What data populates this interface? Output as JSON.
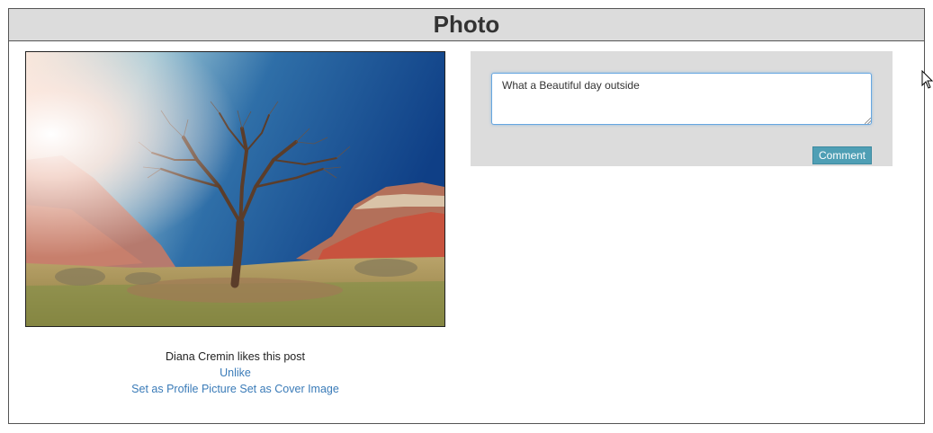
{
  "dialog": {
    "title": "Photo"
  },
  "photo": {
    "subject": "tree-landscape-photo"
  },
  "caption": {
    "likes_text": "Diana Cremin likes this post",
    "unlike_label": "Unlike",
    "profile_picture_label": "Set as Profile Picture",
    "cover_image_label": "Set as Cover Image"
  },
  "comment": {
    "input_value": "What a Beautiful day outside",
    "submit_label": "Comment"
  },
  "icons": {
    "cursor": "mouse-pointer-icon"
  },
  "colors": {
    "header_bg": "#dcdcdc",
    "link": "#3a7bb8",
    "button_bg": "#4f9fb5",
    "input_focus_border": "#66a6e0"
  }
}
